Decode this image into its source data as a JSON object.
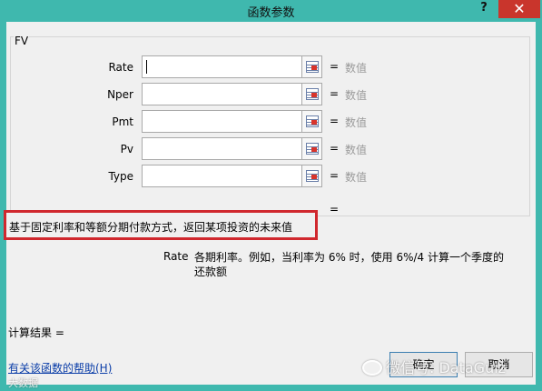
{
  "window": {
    "title": "函数参数",
    "help_glyph": "?",
    "close_glyph": "✕"
  },
  "function": {
    "name": "FV",
    "arguments": [
      {
        "label": "Rate",
        "value": "",
        "result": "数值",
        "icon": "range-select-icon"
      },
      {
        "label": "Nper",
        "value": "",
        "result": "数值",
        "icon": "range-select-icon"
      },
      {
        "label": "Pmt",
        "value": "",
        "result": "数值",
        "icon": "range-select-icon"
      },
      {
        "label": "Pv",
        "value": "",
        "result": "数值",
        "icon": "range-select-icon"
      },
      {
        "label": "Type",
        "value": "",
        "result": "数值",
        "icon": "range-select-icon"
      }
    ],
    "equals": "=",
    "description": "基于固定利率和等额分期付款方式，返回某项投资的未来值",
    "param_name": "Rate",
    "param_description": "各期利率。例如，当利率为 6% 时，使用 6%/4 计算一个季度的还款额"
  },
  "footer": {
    "calc_result": "计算结果 =",
    "help_link": "有关该函数的帮助(H)",
    "ok_label": "确定",
    "cancel_label": "取消"
  },
  "watermark": {
    "main": "微信号: DataGuiz",
    "small": "大数据"
  },
  "colors": {
    "title_bar": "#3fb8ae",
    "close_button": "#c9352c",
    "highlight_border": "#d0282e",
    "link": "#0b3ea8"
  }
}
